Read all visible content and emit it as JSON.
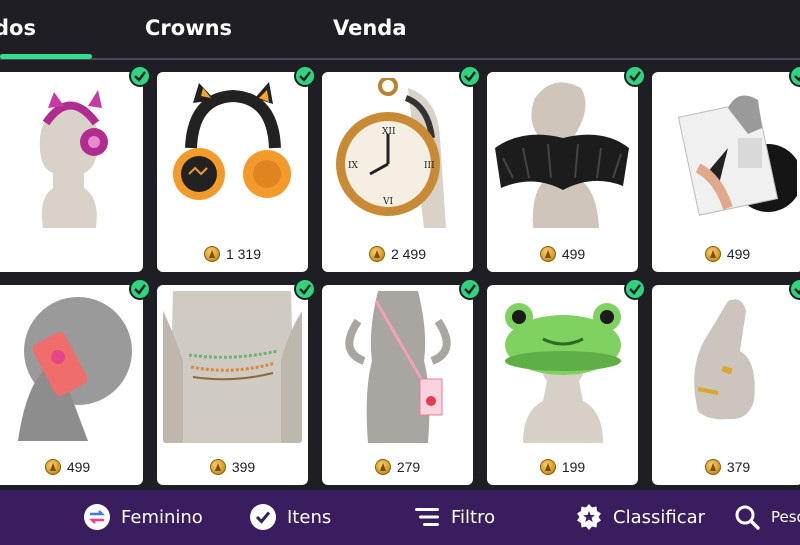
{
  "tabs": [
    {
      "label": "dos"
    },
    {
      "label": "Crowns"
    },
    {
      "label": "Venda"
    }
  ],
  "accent_color": "#2fe08c",
  "items": [
    {
      "name": "cat-ear-headphones-pink",
      "price": ""
    },
    {
      "name": "pumpkin-cat-headphones",
      "price": "1 319"
    },
    {
      "name": "pocket-watch-backpack",
      "price": "2 499"
    },
    {
      "name": "black-ruffle-collar",
      "price": "499"
    },
    {
      "name": "vinyl-record-accessory",
      "price": "499"
    },
    {
      "name": "phone-case-pink",
      "price": "499"
    },
    {
      "name": "beaded-waist-chains",
      "price": "399"
    },
    {
      "name": "milk-carton-bag",
      "price": "279"
    },
    {
      "name": "frog-hat",
      "price": "199"
    },
    {
      "name": "gold-rings",
      "price": "379"
    }
  ],
  "bottom_bar": {
    "gender_label": "Feminino",
    "items_label": "Itens",
    "filter_label": "Filtro",
    "sort_label": "Classificar",
    "search_label": "Pesqu"
  },
  "icons": [
    "swap-icon",
    "check-circle-icon",
    "filter-lines-icon",
    "badge-star-icon",
    "search-icon"
  ]
}
